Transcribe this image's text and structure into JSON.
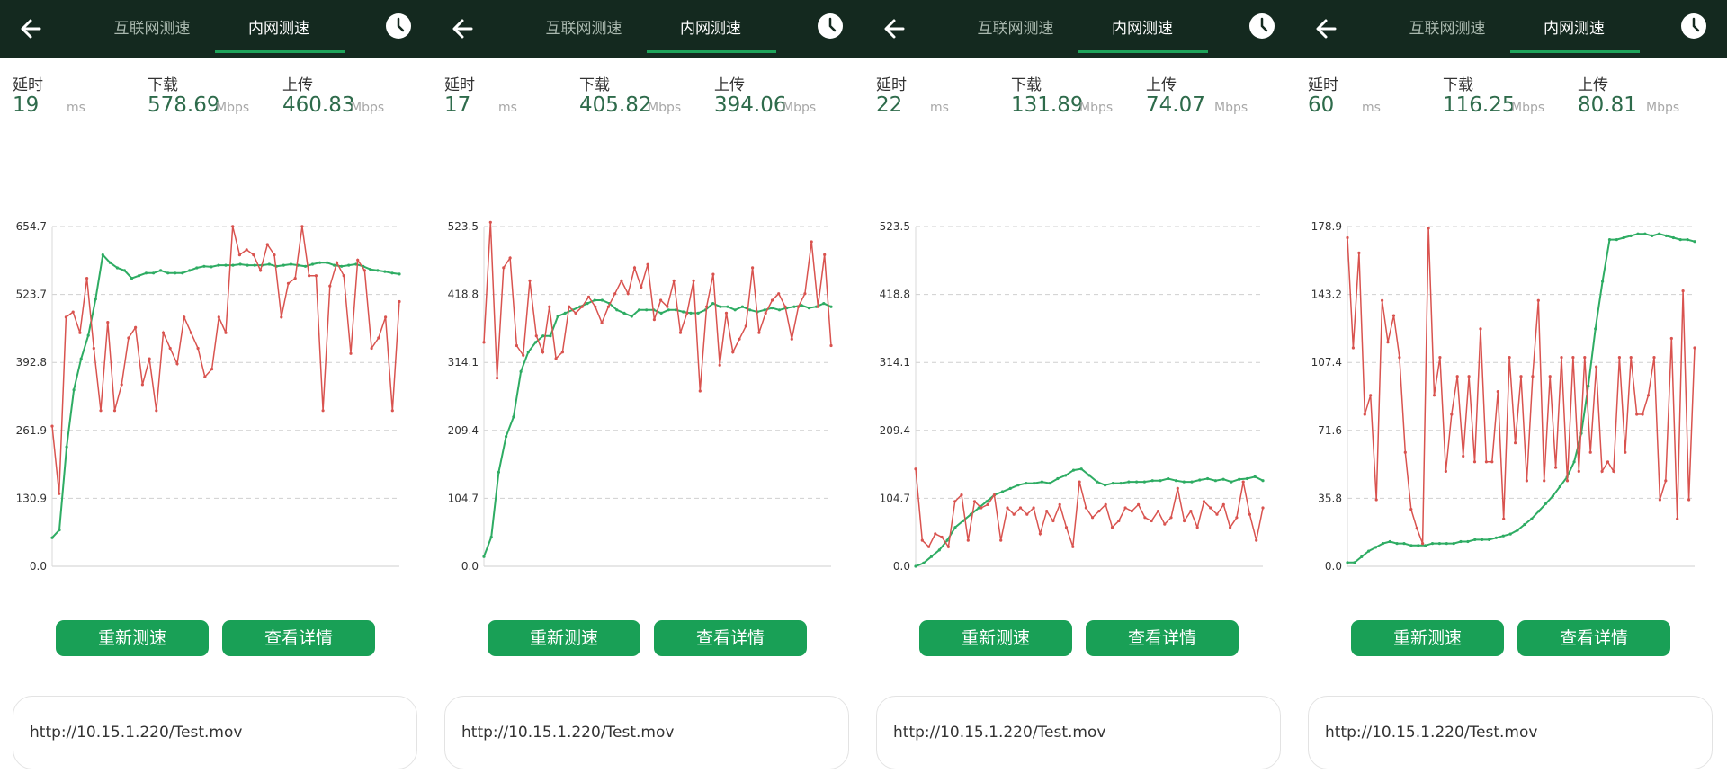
{
  "colors": {
    "topbar": "#14291f",
    "accent": "#19a056",
    "download_line": "#2eac63",
    "upload_line": "#d9534f"
  },
  "panels": [
    {
      "tabs": [
        "互联网测速",
        "内网测速"
      ],
      "metrics": {
        "latency": {
          "label": "延时",
          "value": "19",
          "unit": "ms"
        },
        "download": {
          "label": "下载",
          "value": "578.69",
          "unit": "Mbps"
        },
        "upload": {
          "label": "上传",
          "value": "460.83",
          "unit": "Mbps"
        }
      },
      "buttons": {
        "retest": "重新测速",
        "details": "查看详情"
      },
      "url": "http://10.15.1.220/Test.mov"
    },
    {
      "tabs": [
        "互联网测速",
        "内网测速"
      ],
      "metrics": {
        "latency": {
          "label": "延时",
          "value": "17",
          "unit": "ms"
        },
        "download": {
          "label": "下载",
          "value": "405.82",
          "unit": "Mbps"
        },
        "upload": {
          "label": "上传",
          "value": "394.06",
          "unit": "Mbps"
        }
      },
      "buttons": {
        "retest": "重新测速",
        "details": "查看详情"
      },
      "url": "http://10.15.1.220/Test.mov"
    },
    {
      "tabs": [
        "互联网测速",
        "内网测速"
      ],
      "metrics": {
        "latency": {
          "label": "延时",
          "value": "22",
          "unit": "ms"
        },
        "download": {
          "label": "下载",
          "value": "131.89",
          "unit": "Mbps"
        },
        "upload": {
          "label": "上传",
          "value": "74.07",
          "unit": "Mbps"
        }
      },
      "buttons": {
        "retest": "重新测速",
        "details": "查看详情"
      },
      "url": "http://10.15.1.220/Test.mov"
    },
    {
      "tabs": [
        "互联网测速",
        "内网测速"
      ],
      "metrics": {
        "latency": {
          "label": "延时",
          "value": "60",
          "unit": "ms"
        },
        "download": {
          "label": "下载",
          "value": "116.25",
          "unit": "Mbps"
        },
        "upload": {
          "label": "上传",
          "value": "80.81",
          "unit": "Mbps"
        }
      },
      "buttons": {
        "retest": "重新测速",
        "details": "查看详情"
      },
      "url": "http://10.15.1.220/Test.mov"
    }
  ],
  "chart_data": [
    {
      "type": "line",
      "y_ticks": [
        "0.0",
        "130.9",
        "261.9",
        "392.8",
        "523.7",
        "654.7"
      ],
      "ylim": [
        0,
        654.7
      ],
      "grid": true,
      "series": [
        {
          "values": [
            55,
            70,
            230,
            340,
            400,
            445,
            515,
            600,
            585,
            575,
            570,
            555,
            560,
            565,
            565,
            570,
            565,
            565,
            565,
            570,
            575,
            578,
            577,
            580,
            580,
            580,
            582,
            580,
            580,
            580,
            582,
            578,
            580,
            582,
            580,
            578,
            582,
            585,
            585,
            580,
            578,
            580,
            582,
            578,
            572,
            570,
            568,
            565,
            563
          ]
        },
        {
          "values": [
            270,
            140,
            480,
            490,
            450,
            555,
            420,
            300,
            470,
            300,
            350,
            440,
            460,
            350,
            400,
            300,
            450,
            420,
            390,
            480,
            450,
            420,
            365,
            380,
            480,
            450,
            655,
            600,
            610,
            600,
            570,
            620,
            600,
            480,
            545,
            555,
            655,
            560,
            560,
            300,
            540,
            585,
            560,
            410,
            590,
            570,
            420,
            440,
            480,
            300,
            510
          ]
        }
      ]
    },
    {
      "type": "line",
      "y_ticks": [
        "0.0",
        "104.7",
        "209.4",
        "314.1",
        "418.8",
        "523.5"
      ],
      "ylim": [
        0,
        523.5
      ],
      "grid": true,
      "series": [
        {
          "values": [
            15,
            45,
            145,
            200,
            230,
            300,
            330,
            345,
            355,
            355,
            385,
            390,
            395,
            400,
            405,
            410,
            410,
            405,
            395,
            390,
            385,
            395,
            395,
            395,
            390,
            395,
            395,
            392,
            390,
            390,
            395,
            405,
            400,
            400,
            395,
            400,
            395,
            392,
            395,
            398,
            395,
            398,
            400,
            402,
            398,
            400,
            405,
            400
          ]
        },
        {
          "values": [
            345,
            530,
            290,
            460,
            475,
            340,
            325,
            440,
            355,
            330,
            400,
            320,
            330,
            400,
            390,
            400,
            415,
            400,
            375,
            400,
            420,
            440,
            420,
            460,
            430,
            465,
            380,
            410,
            400,
            440,
            360,
            390,
            440,
            270,
            400,
            450,
            310,
            390,
            330,
            350,
            370,
            460,
            360,
            390,
            410,
            420,
            400,
            350,
            400,
            420,
            500,
            400,
            480,
            340
          ]
        }
      ]
    },
    {
      "type": "line",
      "y_ticks": [
        "0.0",
        "104.7",
        "209.4",
        "314.1",
        "418.8",
        "523.5"
      ],
      "ylim": [
        0,
        523.5
      ],
      "grid": true,
      "series": [
        {
          "values": [
            0,
            5,
            15,
            25,
            40,
            60,
            70,
            80,
            90,
            100,
            110,
            115,
            120,
            125,
            128,
            128,
            130,
            128,
            135,
            140,
            148,
            150,
            140,
            130,
            125,
            128,
            128,
            130,
            130,
            130,
            132,
            132,
            135,
            132,
            130,
            130,
            133,
            135,
            132,
            134,
            130,
            134,
            135,
            138,
            132
          ]
        },
        {
          "values": [
            150,
            40,
            30,
            50,
            45,
            30,
            100,
            110,
            40,
            100,
            90,
            95,
            110,
            40,
            90,
            80,
            90,
            80,
            90,
            50,
            85,
            70,
            95,
            60,
            30,
            130,
            90,
            75,
            85,
            95,
            60,
            70,
            90,
            85,
            95,
            75,
            70,
            85,
            65,
            75,
            120,
            70,
            85,
            60,
            100,
            90,
            80,
            95,
            60,
            75,
            130,
            80,
            40,
            90
          ]
        }
      ]
    },
    {
      "type": "line",
      "y_ticks": [
        "0.0",
        "35.8",
        "71.6",
        "107.4",
        "143.2",
        "178.9"
      ],
      "ylim": [
        0,
        178.9
      ],
      "grid": true,
      "series": [
        {
          "values": [
            2,
            2,
            5,
            8,
            10,
            12,
            13,
            12,
            12,
            11,
            11,
            11,
            12,
            12,
            12,
            12,
            13,
            13,
            14,
            14,
            14,
            15,
            16,
            17,
            19,
            22,
            25,
            29,
            33,
            37,
            42,
            47,
            55,
            70,
            95,
            125,
            150,
            172,
            172,
            173,
            174,
            175,
            175,
            174,
            175,
            174,
            173,
            172,
            172,
            171
          ]
        },
        {
          "values": [
            173,
            115,
            165,
            80,
            90,
            35,
            140,
            118,
            132,
            110,
            60,
            30,
            20,
            12,
            178,
            90,
            110,
            50,
            80,
            100,
            58,
            100,
            55,
            125,
            55,
            55,
            92,
            25,
            110,
            65,
            100,
            45,
            100,
            140,
            45,
            100,
            52,
            110,
            45,
            110,
            50,
            110,
            60,
            105,
            50,
            55,
            50,
            110,
            60,
            110,
            80,
            80,
            90,
            110,
            35,
            45,
            120,
            25,
            145,
            35,
            115
          ]
        }
      ]
    }
  ]
}
